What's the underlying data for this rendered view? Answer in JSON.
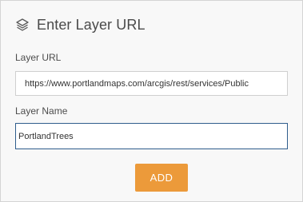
{
  "dialog": {
    "title": "Enter Layer URL",
    "icon": "layers-icon"
  },
  "layer_url": {
    "label": "Layer URL",
    "value": "https://www.portlandmaps.com/arcgis/rest/services/Public"
  },
  "layer_name": {
    "label": "Layer Name",
    "value": "PortlandTrees"
  },
  "add_button": {
    "label": "ADD",
    "color": "#ec9a3a"
  }
}
